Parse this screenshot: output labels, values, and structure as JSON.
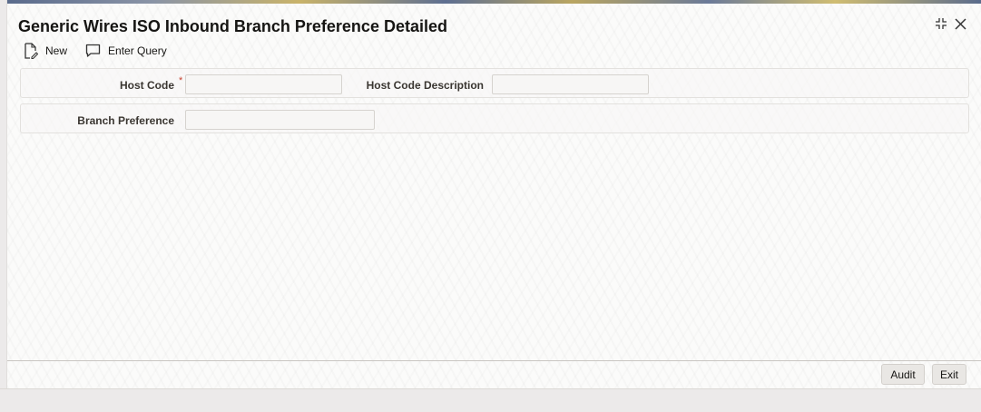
{
  "window": {
    "title": "Generic Wires ISO Inbound Branch Preference Detailed",
    "controls": {
      "restore_glyph": "⤡",
      "close_glyph": "✕"
    }
  },
  "toolbar": {
    "new_label": "New",
    "enter_query_label": "Enter Query"
  },
  "form": {
    "host_code": {
      "label": "Host Code",
      "required_mark": "*",
      "value": ""
    },
    "host_code_description": {
      "label": "Host Code Description",
      "value": ""
    },
    "branch_preference": {
      "label": "Branch Preference",
      "value": ""
    }
  },
  "footer": {
    "audit_label": "Audit",
    "exit_label": "Exit"
  },
  "colors": {
    "required": "#c74634",
    "text": "#161513"
  }
}
